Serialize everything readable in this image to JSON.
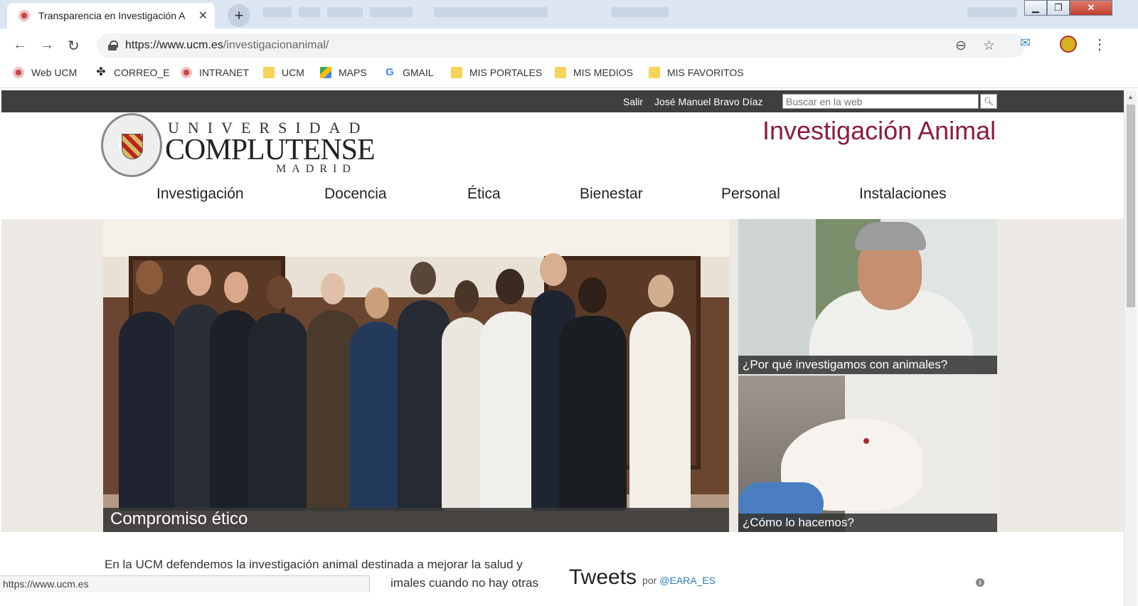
{
  "browser": {
    "tab_title": "Transparencia en Investigación A",
    "url_host": "https://www.ucm.es",
    "url_path": "/investigacionanimal/",
    "status_url": "https://www.ucm.es",
    "bookmarks": [
      {
        "label": "Web UCM",
        "icon": "ucm-icon"
      },
      {
        "label": "CORREO_E",
        "icon": "correo-icon"
      },
      {
        "label": "INTRANET",
        "icon": "ucm-icon"
      },
      {
        "label": "UCM",
        "icon": "folder-icon"
      },
      {
        "label": "MAPS",
        "icon": "maps-icon"
      },
      {
        "label": "GMAIL",
        "icon": "google-icon"
      },
      {
        "label": "MIS PORTALES",
        "icon": "folder-icon"
      },
      {
        "label": "MIS MEDIOS",
        "icon": "folder-icon"
      },
      {
        "label": "MIS FAVORITOS",
        "icon": "folder-icon"
      }
    ]
  },
  "topbar": {
    "logout": "Salir",
    "user": "José Manuel Bravo Díaz",
    "search_placeholder": "Buscar en la web"
  },
  "logo": {
    "line1": "UNIVERSIDAD",
    "line2": "COMPLUTENSE",
    "line3": "MADRID"
  },
  "site_title": "Investigación Animal",
  "nav": [
    "Investigación",
    "Docencia",
    "Ética",
    "Bienestar",
    "Personal",
    "Instalaciones"
  ],
  "hero": {
    "main_caption": "Compromiso ético",
    "side1_caption": "¿Por qué investigamos con animales?",
    "side2_caption": "¿Cómo lo hacemos?"
  },
  "body": {
    "line1": "En la UCM defendemos la investigación animal destinada a mejorar la salud y",
    "line2": "imales cuando no hay otras"
  },
  "tweets": {
    "title": "Tweets",
    "by": "por",
    "handle": "@EARA_ES"
  },
  "colors": {
    "accent": "#8b1c3d",
    "topbar": "#3f3f3f"
  }
}
